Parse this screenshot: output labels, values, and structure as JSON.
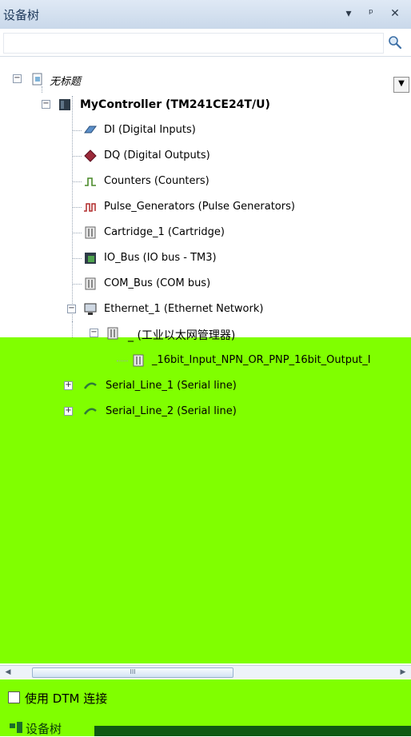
{
  "panel": {
    "title": "设备树"
  },
  "search": {
    "value": "",
    "placeholder": ""
  },
  "tree": {
    "root": "无标题",
    "controller": "MyController (TM241CE24T/U)",
    "items": [
      "DI (Digital Inputs)",
      "DQ (Digital Outputs)",
      "Counters (Counters)",
      "Pulse_Generators (Pulse Generators)",
      "Cartridge_1 (Cartridge)",
      "IO_Bus (IO bus - TM3)",
      "COM_Bus (COM bus)",
      "Ethernet_1 (Ethernet Network)"
    ],
    "ethernet_child": "_ (工业以太网管理器)",
    "ethernet_grandchild": "_16bit_Input_NPN_OR_PNP_16bit_Output_I",
    "serial1": "Serial_Line_1 (Serial line)",
    "serial2": "Serial_Line_2 (Serial line)"
  },
  "scrollbar": {
    "thumb_label": "III"
  },
  "bottom": {
    "dtm_label": "使用 DTM 连接",
    "tab_label": "设备树"
  },
  "colors": {
    "overlay": "#80ff00",
    "titlebar": "#dfe9f5"
  }
}
